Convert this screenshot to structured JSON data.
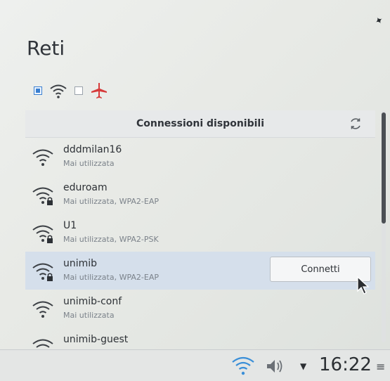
{
  "applet": {
    "title": "Reti",
    "toolbar": {
      "networking_enabled": true,
      "wifi_enabled": false,
      "airplane_mode_color": "#d63b3b"
    }
  },
  "connections": {
    "header": "Connessioni disponibili",
    "connect_label": "Connetti",
    "networks": [
      {
        "name": "dddmilan16",
        "status": "Mai utilizzata",
        "secured": false,
        "icon": "wifi-icon"
      },
      {
        "name": "eduroam",
        "status": "Mai utilizzata, WPA2-EAP",
        "secured": true,
        "icon": "wifi-lock-icon"
      },
      {
        "name": "U1",
        "status": "Mai utilizzata, WPA2-PSK",
        "secured": true,
        "icon": "wifi-lock-icon"
      },
      {
        "name": "unimib",
        "status": "Mai utilizzata, WPA2-EAP",
        "secured": true,
        "icon": "wifi-lock-icon",
        "selected": true
      },
      {
        "name": "unimib-conf",
        "status": "Mai utilizzata",
        "secured": false,
        "icon": "wifi-icon"
      },
      {
        "name": "unimib-guest",
        "status": "",
        "secured": false,
        "icon": "wifi-icon"
      }
    ]
  },
  "taskbar": {
    "clock": "16:22",
    "accent": "#3a8fd8"
  }
}
